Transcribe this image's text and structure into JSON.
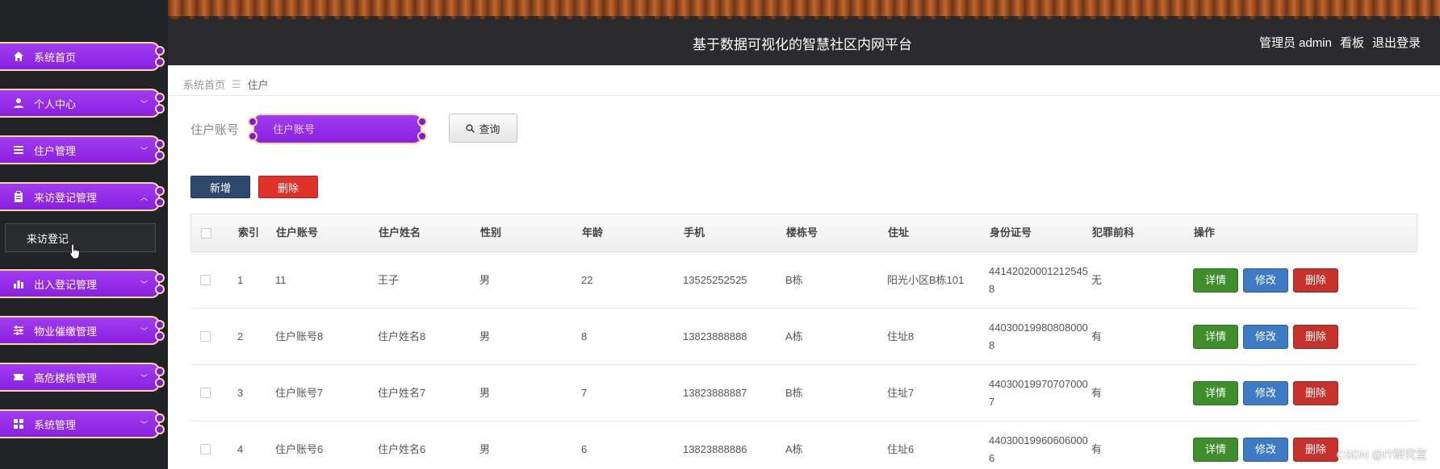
{
  "header": {
    "title": "基于数据可视化的智慧社区内网平台",
    "admin_label": "管理员 admin",
    "board_label": "看板",
    "logout_label": "退出登录"
  },
  "sidebar": {
    "items": [
      {
        "label": "系统首页",
        "icon": "home-icon"
      },
      {
        "label": "个人中心",
        "icon": "user-icon"
      },
      {
        "label": "住户管理",
        "icon": "list-icon"
      },
      {
        "label": "来访登记管理",
        "icon": "clipboard-icon"
      },
      {
        "label": "出入登记管理",
        "icon": "bar-chart-icon"
      },
      {
        "label": "物业催缴管理",
        "icon": "sliders-icon"
      },
      {
        "label": "高危楼栋管理",
        "icon": "ticket-icon"
      },
      {
        "label": "系统管理",
        "icon": "grid-icon"
      }
    ],
    "submenu": {
      "label": "来访登记"
    }
  },
  "breadcrumb": {
    "home": "系统首页",
    "separator": "☰",
    "current": "住户"
  },
  "search": {
    "label": "住户账号",
    "placeholder": "住户账号",
    "button_label": "查询"
  },
  "actions": {
    "add_label": "新增",
    "delete_label": "删除"
  },
  "table": {
    "columns": [
      "索引",
      "住户账号",
      "住户姓名",
      "性别",
      "年龄",
      "手机",
      "楼栋号",
      "住址",
      "身份证号",
      "犯罪前科",
      "操作"
    ],
    "op_labels": {
      "detail": "详情",
      "edit": "修改",
      "delete": "删除"
    },
    "rows": [
      {
        "idx": "1",
        "account": "11",
        "name": "王子",
        "sex": "男",
        "age": "22",
        "phone": "13525252525",
        "building": "B栋",
        "address": "阳光小区B栋101",
        "id_card": "441420200012125458",
        "crime": "无"
      },
      {
        "idx": "2",
        "account": "住户账号8",
        "name": "住户姓名8",
        "sex": "男",
        "age": "8",
        "phone": "13823888888",
        "building": "A栋",
        "address": "住址8",
        "id_card": "440300199808080008",
        "crime": "有"
      },
      {
        "idx": "3",
        "account": "住户账号7",
        "name": "住户姓名7",
        "sex": "男",
        "age": "7",
        "phone": "13823888887",
        "building": "B栋",
        "address": "住址7",
        "id_card": "440300199707070007",
        "crime": "有"
      },
      {
        "idx": "4",
        "account": "住户账号6",
        "name": "住户姓名6",
        "sex": "男",
        "age": "6",
        "phone": "13823888886",
        "building": "A栋",
        "address": "住址6",
        "id_card": "440300199606060006",
        "crime": "有"
      }
    ]
  },
  "watermark": "CSDN @IT研究室",
  "colors": {
    "menu_purple": "#9a33ea",
    "menu_border": "#f3d79c",
    "add_button": "#2d4a6e",
    "delete_button": "#e0312b",
    "detail_button": "#3e8f2b",
    "edit_button": "#3d7bc4"
  }
}
